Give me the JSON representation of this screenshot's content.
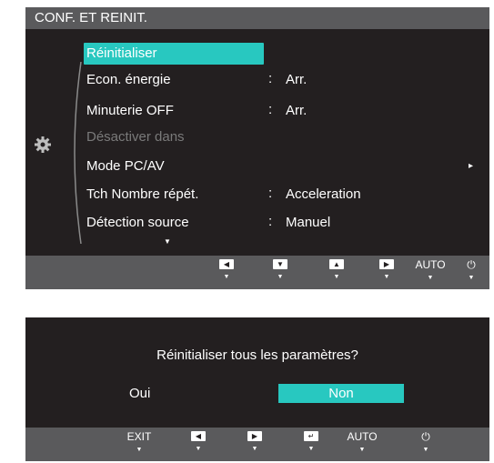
{
  "menu": {
    "title": "CONF. ET REINIT.",
    "items": [
      {
        "label": "Réinitialiser",
        "value": "",
        "colon": "",
        "arrow": ""
      },
      {
        "label": "Econ. énergie",
        "value": "Arr.",
        "colon": ":",
        "arrow": ""
      },
      {
        "label": "Minuterie OFF",
        "value": "Arr.",
        "colon": ":",
        "arrow": ""
      },
      {
        "label": "Désactiver dans",
        "value": "",
        "colon": "",
        "arrow": ""
      },
      {
        "label": "Mode PC/AV",
        "value": "",
        "colon": "",
        "arrow": "▸"
      },
      {
        "label": "Tch Nombre répét.",
        "value": "Acceleration",
        "colon": ":",
        "arrow": ""
      },
      {
        "label": "Détection source",
        "value": "Manuel",
        "colon": ":",
        "arrow": ""
      }
    ],
    "more_indicator": "▼",
    "footer": {
      "left": "◀",
      "down": "▼",
      "up": "▲",
      "right": "▶",
      "auto": "AUTO",
      "power": "⏻",
      "tick": "▼"
    }
  },
  "dialog": {
    "prompt": "Réinitialiser tous les paramètres?",
    "yes": "Oui",
    "no": "Non",
    "footer": {
      "exit": "EXIT",
      "left": "◀",
      "right": "▶",
      "enter": "↵",
      "auto": "AUTO",
      "power": "⏻",
      "tick": "▼"
    }
  },
  "colors": {
    "accent": "#28c8c0",
    "panel": "#231f20",
    "bar": "#5a5a5c"
  },
  "icons": {
    "side": "gear-icon"
  }
}
